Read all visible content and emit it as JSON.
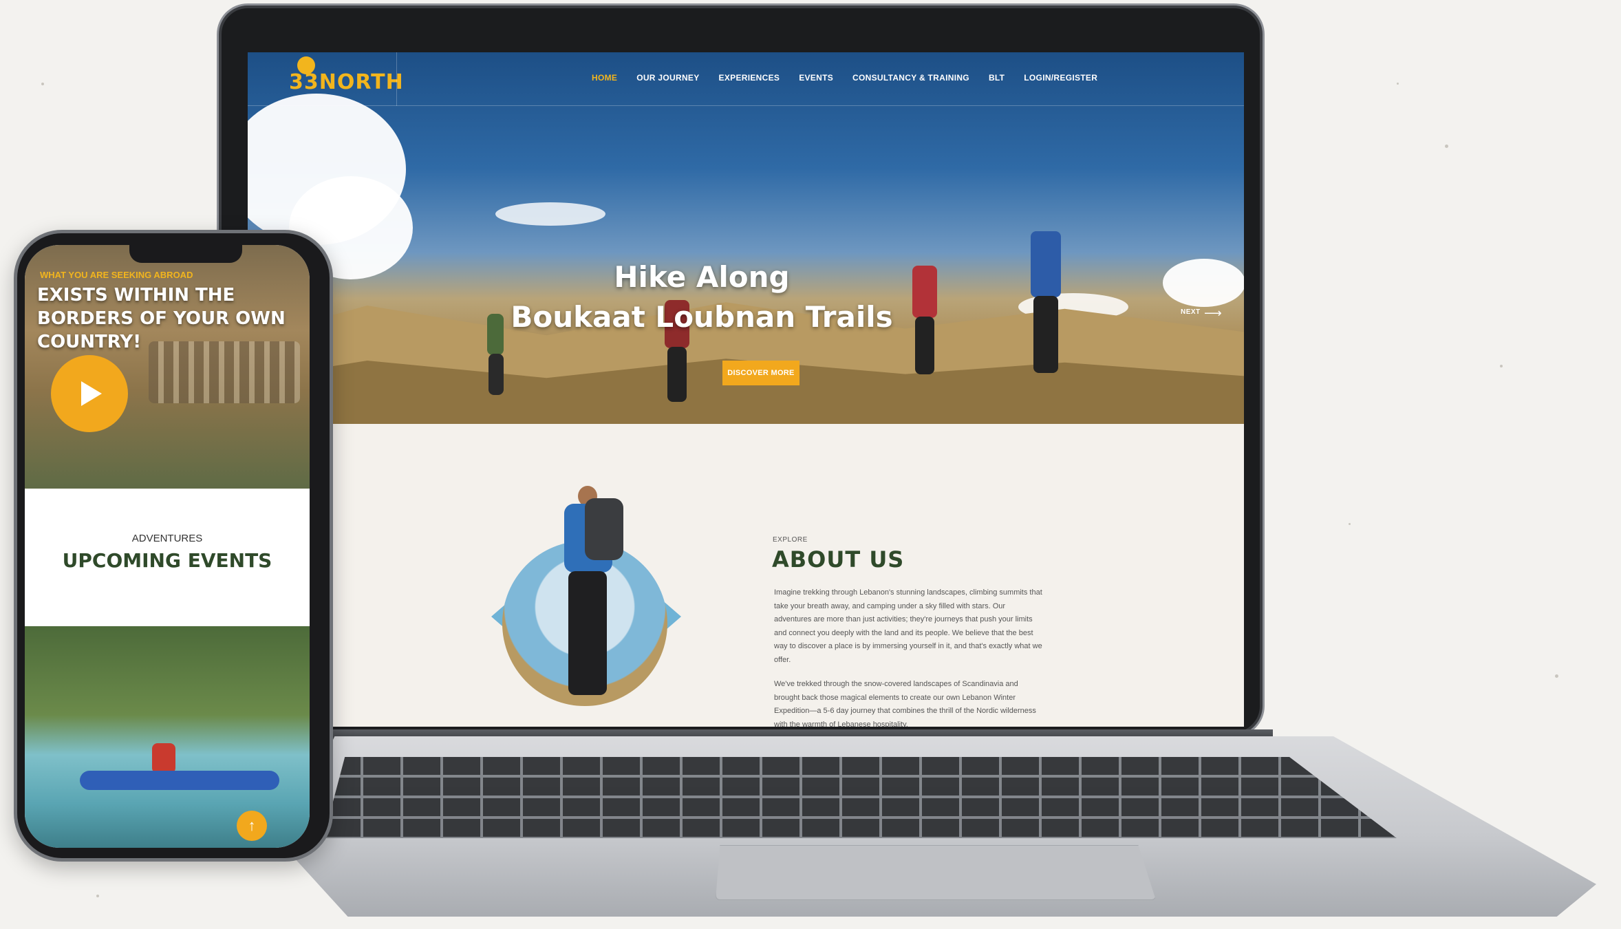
{
  "desktop": {
    "logo": {
      "text": "33NORTH"
    },
    "nav": {
      "items": [
        {
          "label": "HOME",
          "active": true
        },
        {
          "label": "OUR JOURNEY",
          "active": false
        },
        {
          "label": "EXPERIENCES",
          "active": false
        },
        {
          "label": "EVENTS",
          "active": false
        },
        {
          "label": "CONSULTANCY & TRAINING",
          "active": false
        },
        {
          "label": "BLT",
          "active": false
        },
        {
          "label": "LOGIN/REGISTER",
          "active": false
        }
      ]
    },
    "hero": {
      "title_line1": "Hike Along",
      "title_line2": "Boukaat Loubnan Trails",
      "cta_label": "DISCOVER MORE",
      "next_label": "NEXT"
    },
    "about": {
      "eyebrow": "EXPLORE",
      "title": "ABOUT US",
      "paragraph1": "Imagine trekking through Lebanon's stunning landscapes, climbing summits that take your breath away, and camping under a sky filled with stars. Our adventures are more than just activities; they're journeys that push your limits and connect you deeply with the land and its people. We believe that the best way to discover a place is by immersing yourself in it, and that's exactly what we offer.",
      "paragraph2": "We've trekked through the snow-covered landscapes of Scandinavia and brought back those magical elements to create our own Lebanon Winter Expedition—a 5-6 day journey that combines the thrill of the Nordic wilderness with the warmth of Lebanese hospitality."
    }
  },
  "mobile": {
    "hero": {
      "eyebrow": "WHAT YOU ARE SEEKING ABROAD",
      "headline": "EXISTS WITHIN THE BORDERS OF YOUR OWN COUNTRY!"
    },
    "events": {
      "eyebrow": "ADVENTURES",
      "title": "UPCOMING EVENTS"
    },
    "scroll_top_icon": "arrow-up-icon"
  },
  "colors": {
    "accent": "#f2a81d",
    "brand_green": "#2f4a2a",
    "sky": "#2f6aa6"
  }
}
